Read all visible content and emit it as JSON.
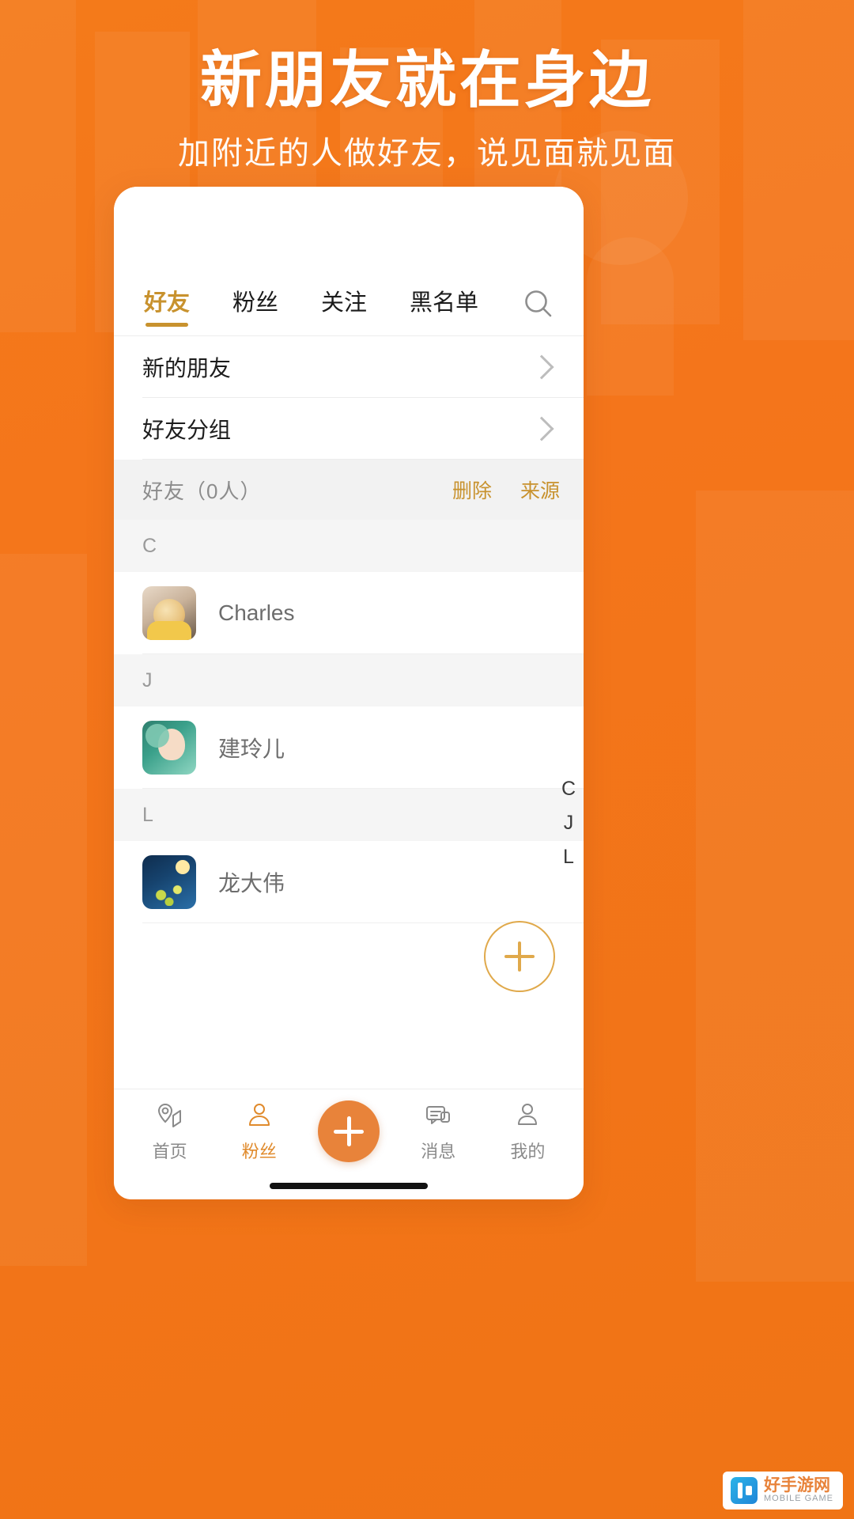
{
  "banner": {
    "title": "新朋友就在身边",
    "subtitle": "加附近的人做好友，说见面就见面",
    "background_color": "#F4751B"
  },
  "app": {
    "accent_color": "#C8922E",
    "tabs": [
      {
        "label": "好友",
        "active": true
      },
      {
        "label": "粉丝",
        "active": false
      },
      {
        "label": "关注",
        "active": false
      },
      {
        "label": "黑名单",
        "active": false
      }
    ],
    "search_icon": "search-icon",
    "nav_rows": [
      {
        "label": "新的朋友",
        "chevron": "chevron-right-icon"
      },
      {
        "label": "好友分组",
        "chevron": "chevron-right-icon"
      }
    ],
    "friends_header": {
      "title": "好友（0人）",
      "actions": [
        {
          "label": "删除"
        },
        {
          "label": "来源"
        }
      ]
    },
    "sections": [
      {
        "letter": "C",
        "contacts": [
          {
            "name": "Charles",
            "avatar": "avatar-charles"
          }
        ]
      },
      {
        "letter": "J",
        "contacts": [
          {
            "name": "建玲儿",
            "avatar": "avatar-jianlinger"
          }
        ]
      },
      {
        "letter": "L",
        "contacts": [
          {
            "name": "龙大伟",
            "avatar": "avatar-longdawei"
          }
        ]
      }
    ],
    "alpha_index": [
      "C",
      "J",
      "L"
    ],
    "fab": {
      "icon": "plus-icon"
    },
    "bottom_nav": [
      {
        "label": "首页",
        "icon": "home-location-icon",
        "active": false
      },
      {
        "label": "粉丝",
        "icon": "fans-icon",
        "active": true
      },
      {
        "label": "",
        "icon": "plus-icon",
        "active": false,
        "center": true
      },
      {
        "label": "消息",
        "icon": "message-icon",
        "active": false
      },
      {
        "label": "我的",
        "icon": "profile-icon",
        "active": false
      }
    ]
  },
  "watermark": {
    "name": "好手游网",
    "sub": "MOBILE GAME"
  }
}
